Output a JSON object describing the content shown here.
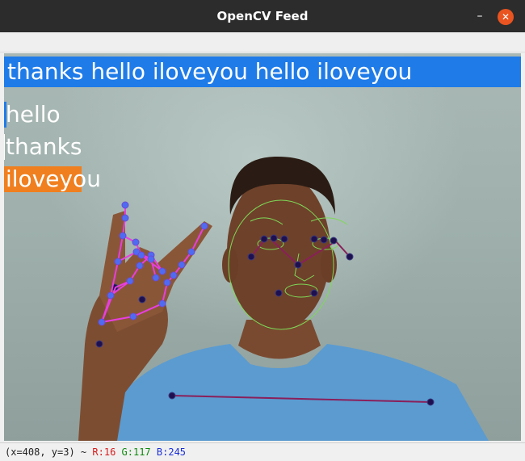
{
  "window": {
    "title": "OpenCV Feed",
    "minimize_glyph": "–",
    "close_glyph": "✕",
    "close_color": "#e95420"
  },
  "overlay": {
    "sentence": "thanks hello iloveyou hello iloveyou",
    "banner_color": "#1f7be8",
    "probabilities": [
      {
        "label": "hello",
        "value": 0.03,
        "color": "#1f7be8"
      },
      {
        "label": "thanks",
        "value": 0.01,
        "color": "#ffffff"
      },
      {
        "label": "iloveyou",
        "value": 0.96,
        "color": "#f07f1f"
      }
    ]
  },
  "status": {
    "coords": "(x=408, y=3) ~",
    "r": "R:16",
    "g": "G:117",
    "b": "B:245"
  },
  "landmark_colors": {
    "hand_line": "#e83ee0",
    "hand_point": "#4f6cf0",
    "face_mesh": "#7ed957",
    "pose_line": "#8a1f5a",
    "pose_point": "#1e1050"
  }
}
